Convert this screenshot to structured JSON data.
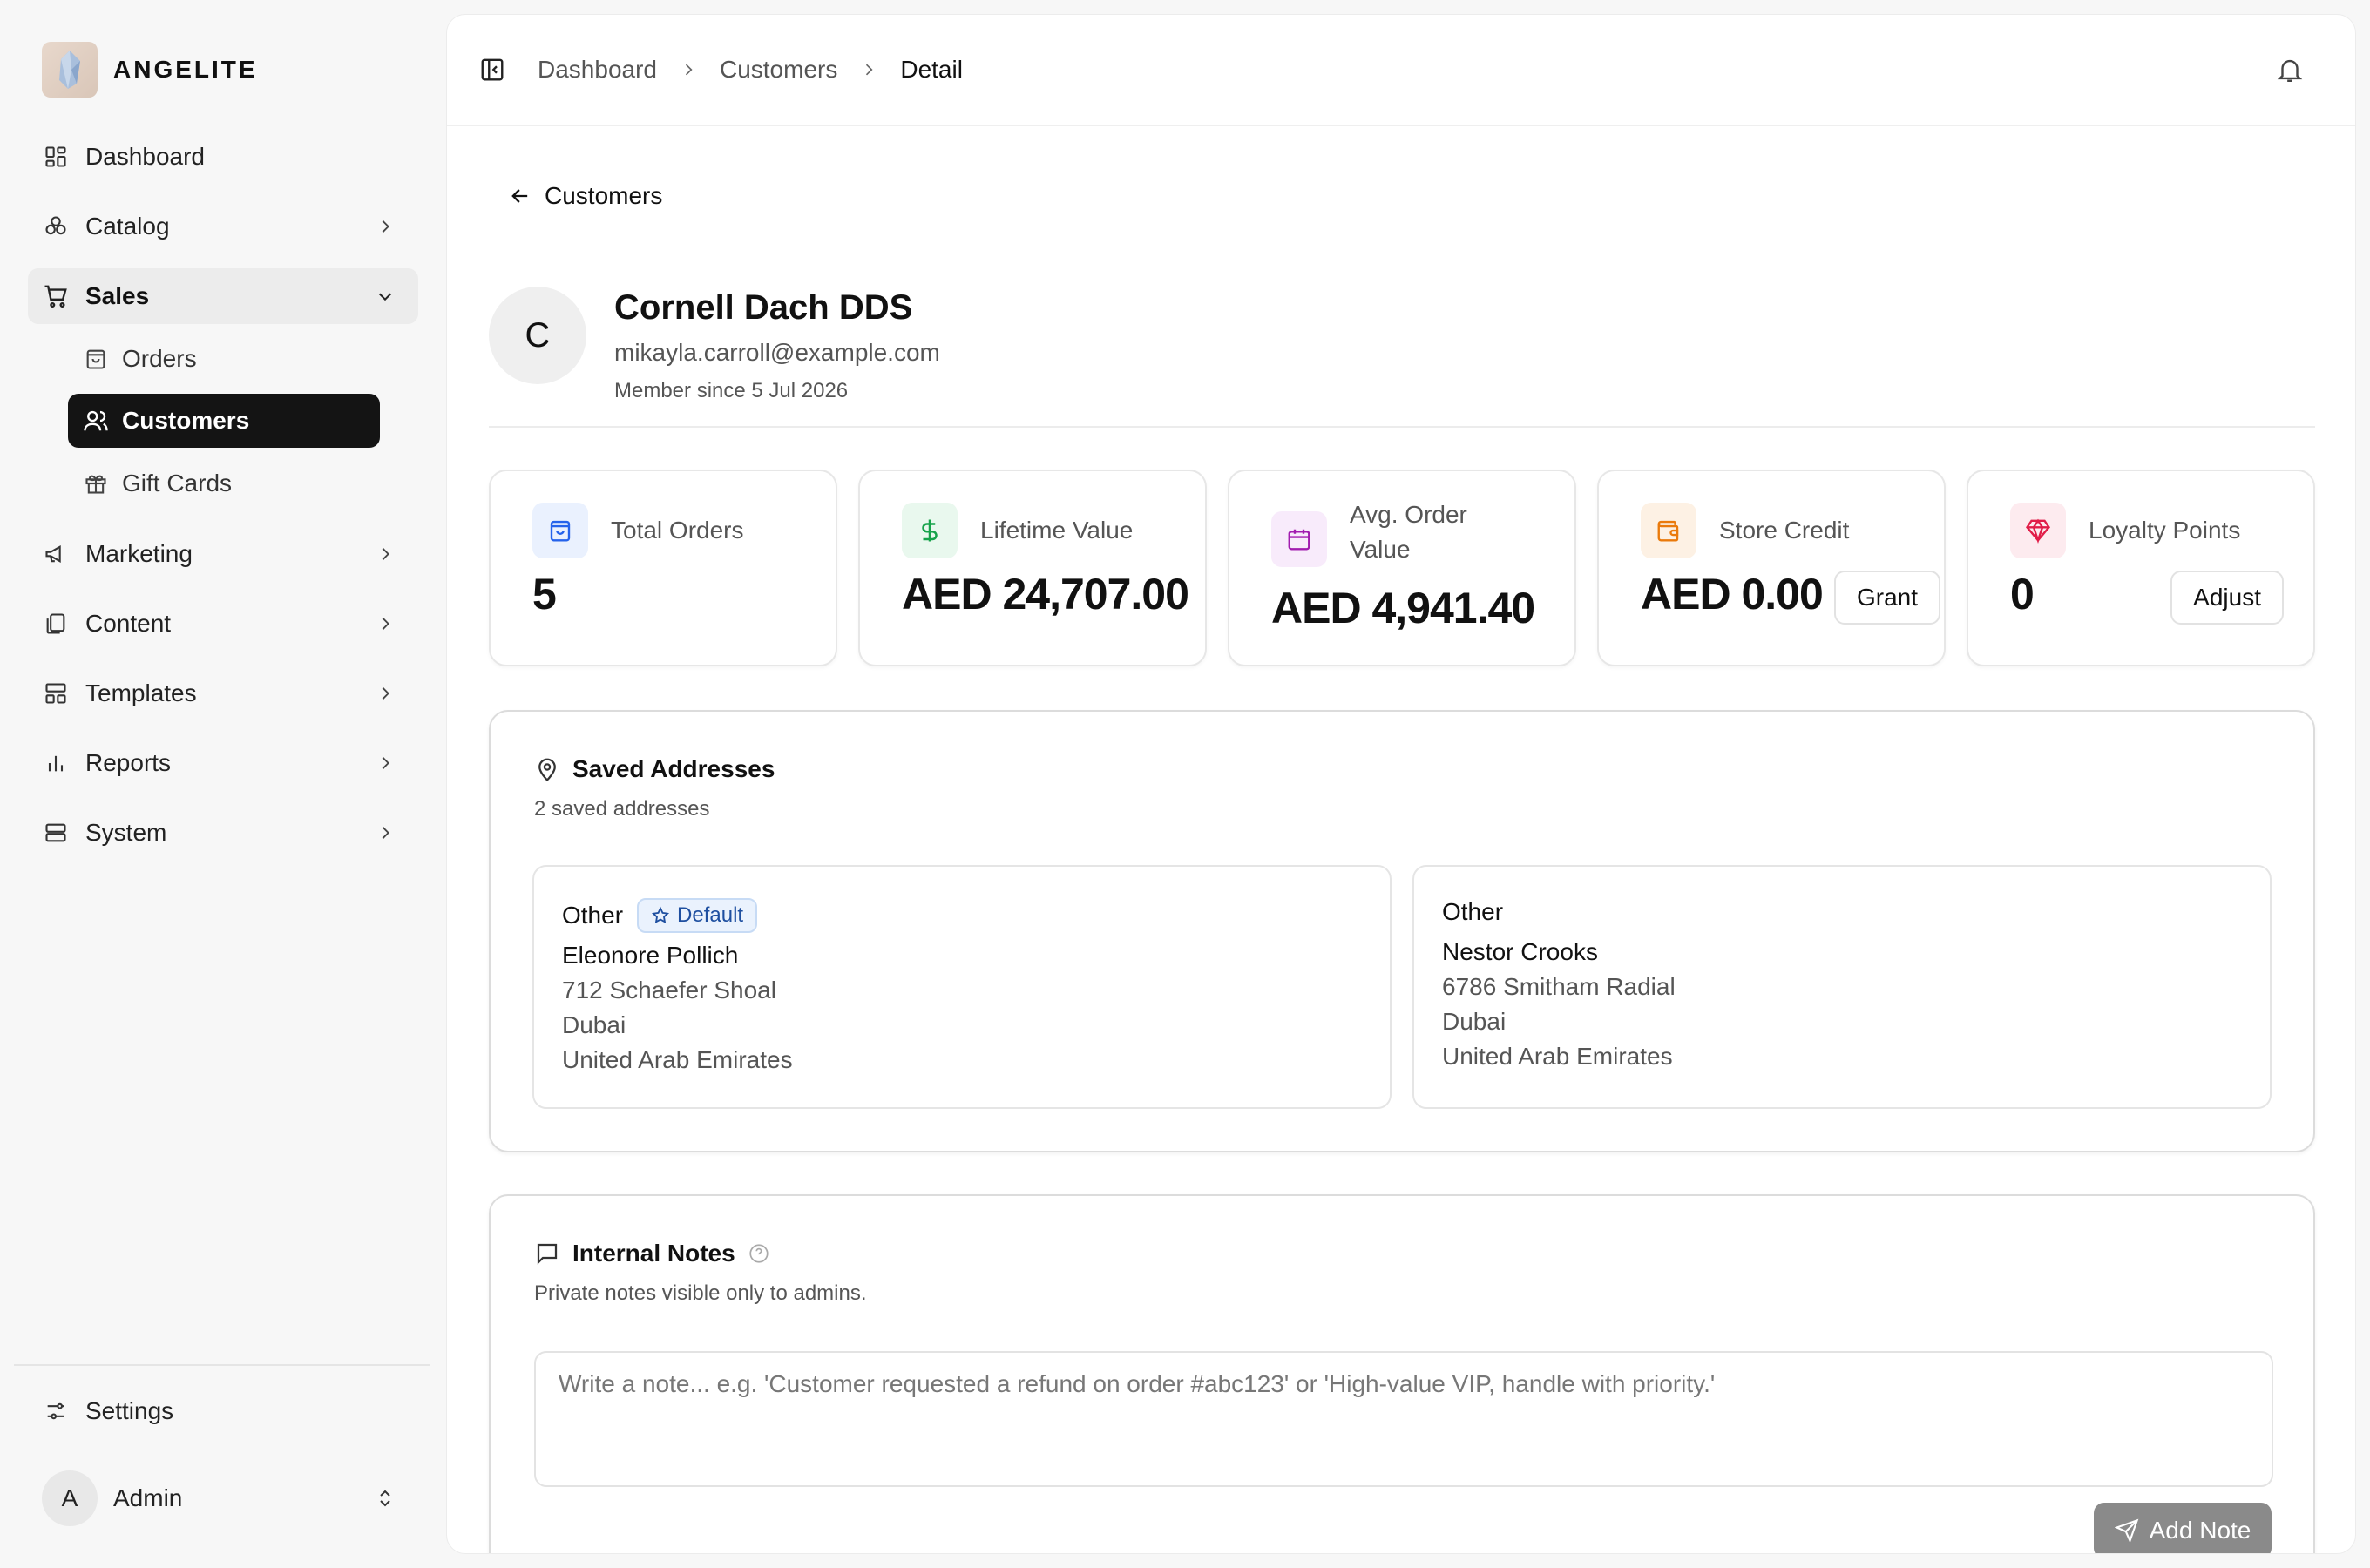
{
  "brand": {
    "name": "ANGELITE",
    "logo_icon": "crystal-logo"
  },
  "sidebar": {
    "items": [
      {
        "label": "Dashboard",
        "icon": "dashboard-icon"
      },
      {
        "label": "Catalog",
        "icon": "catalog-icon"
      },
      {
        "label": "Sales",
        "icon": "cart-icon",
        "expanded": true
      },
      {
        "label": "Marketing",
        "icon": "megaphone-icon"
      },
      {
        "label": "Content",
        "icon": "files-icon"
      },
      {
        "label": "Templates",
        "icon": "layout-icon"
      },
      {
        "label": "Reports",
        "icon": "bar-chart-icon"
      },
      {
        "label": "System",
        "icon": "server-icon"
      }
    ],
    "sales_sub": [
      {
        "label": "Orders",
        "icon": "bag-icon"
      },
      {
        "label": "Customers",
        "icon": "users-icon",
        "active": true
      },
      {
        "label": "Gift Cards",
        "icon": "gift-icon"
      }
    ],
    "settings_label": "Settings",
    "user": {
      "initial": "A",
      "name": "Admin"
    }
  },
  "breadcrumb": {
    "items": [
      "Dashboard",
      "Customers",
      "Detail"
    ]
  },
  "back_label": "Customers",
  "customer": {
    "initial": "C",
    "name": "Cornell Dach DDS",
    "email": "mikayla.carroll@example.com",
    "member_since": "Member since 5 Jul 2026"
  },
  "stats": [
    {
      "label": "Total Orders",
      "value": "5",
      "icon": "bag-icon",
      "color": "#2563eb",
      "bg": "#eaf1fe"
    },
    {
      "label": "Lifetime Value",
      "value": "AED 24,707.00",
      "icon": "dollar-icon",
      "color": "#16a34a",
      "bg": "#e9f8ee"
    },
    {
      "label": "Avg. Order Value",
      "value": "AED 4,941.40",
      "icon": "calendar-icon",
      "color": "#a21caf",
      "bg": "#f8ebfb"
    },
    {
      "label": "Store Credit",
      "value": "AED 0.00",
      "icon": "wallet-icon",
      "color": "#ea7a0c",
      "bg": "#fdf1e4",
      "button": "Grant"
    },
    {
      "label": "Loyalty Points",
      "value": "0",
      "icon": "gem-icon",
      "color": "#e11d48",
      "bg": "#fdebef",
      "button": "Adjust"
    }
  ],
  "addresses": {
    "title": "Saved Addresses",
    "subtitle": "2 saved addresses",
    "items": [
      {
        "type": "Other",
        "badge": "Default",
        "name": "Eleonore Pollich",
        "street": "712 Schaefer Shoal",
        "city": "Dubai",
        "country": "United Arab Emirates"
      },
      {
        "type": "Other",
        "name": "Nestor Crooks",
        "street": "6786 Smitham Radial",
        "city": "Dubai",
        "country": "United Arab Emirates"
      }
    ]
  },
  "notes": {
    "title": "Internal Notes",
    "subtitle": "Private notes visible only to admins.",
    "placeholder": "Write a note... e.g. 'Customer requested a refund on order #abc123' or 'High-value VIP, handle with priority.'",
    "button": "Add Note"
  }
}
